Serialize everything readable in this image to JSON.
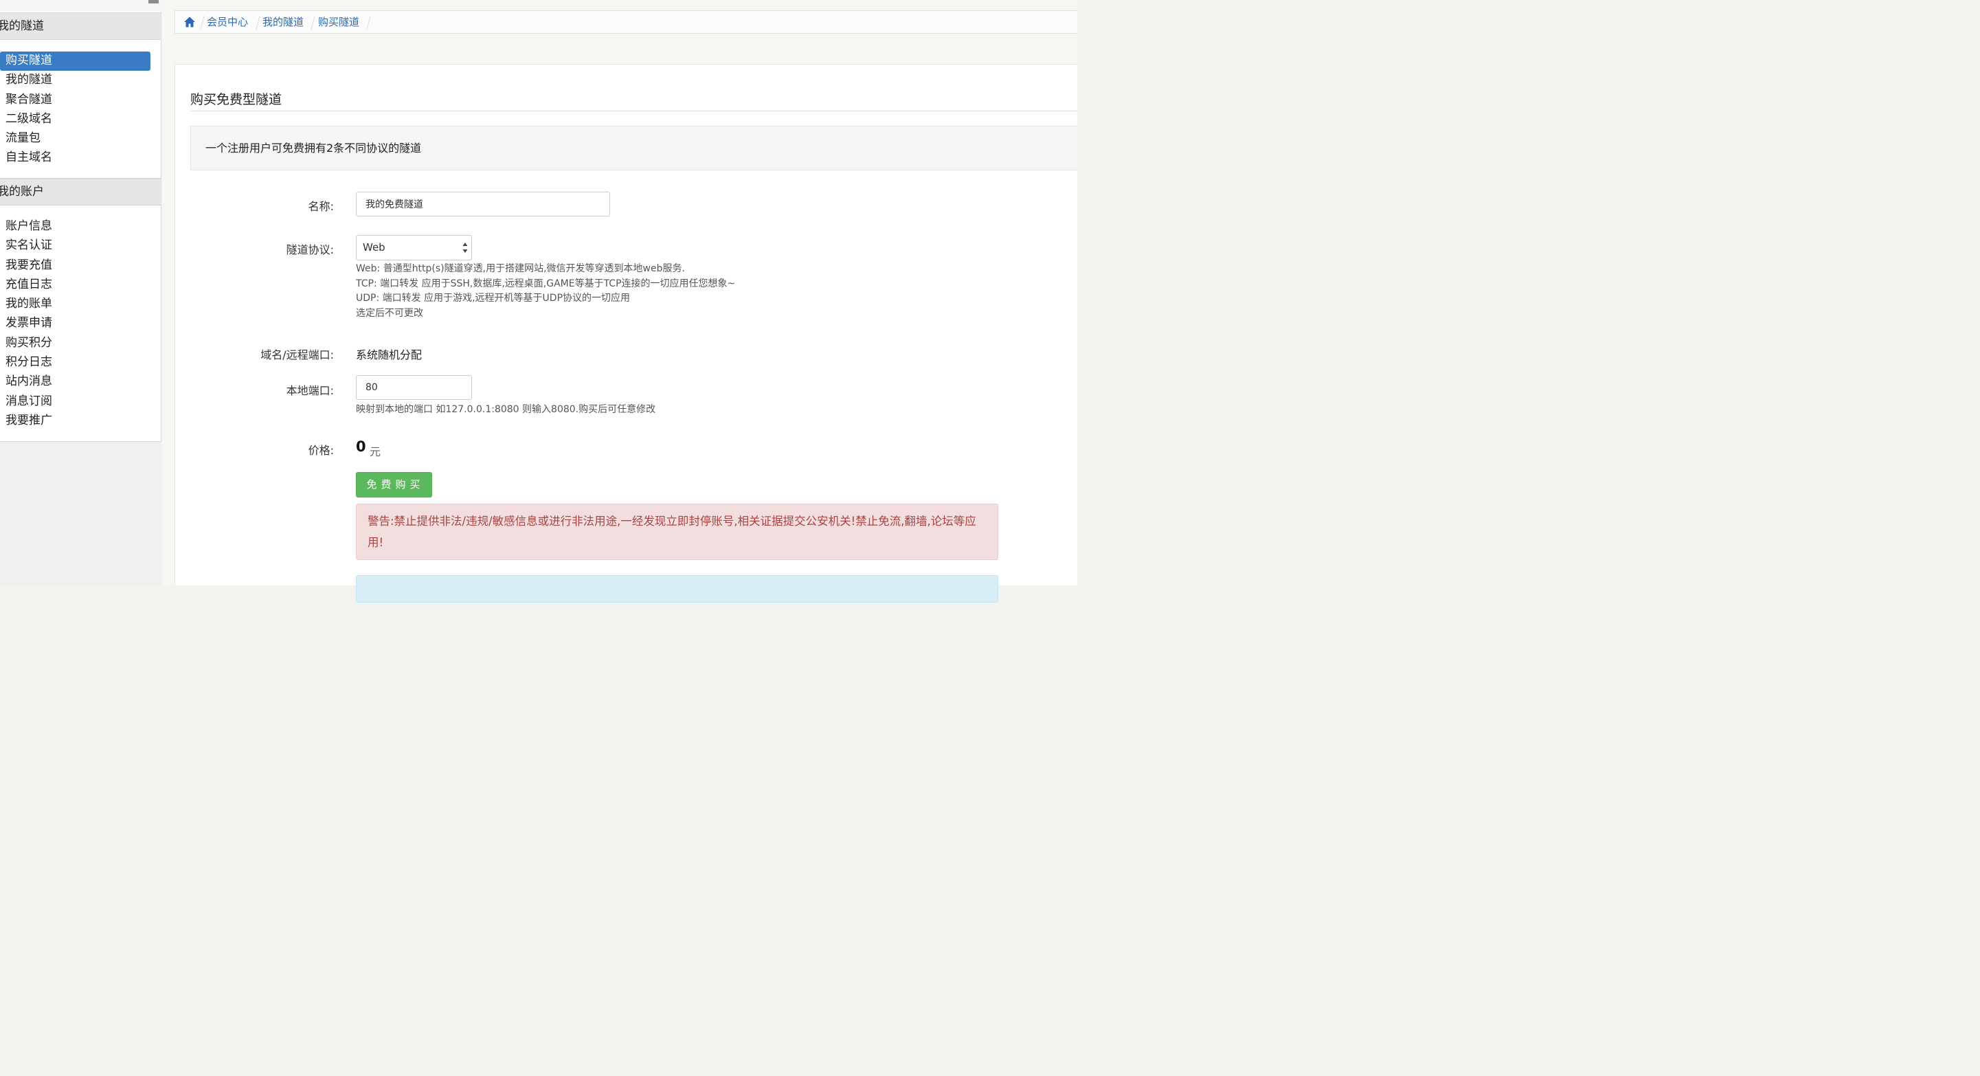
{
  "sidebar": {
    "section1_title": "我的隧道",
    "section1_items": [
      "购买隧道",
      "我的隧道",
      "聚合隧道",
      "二级域名",
      "流量包",
      "自主域名"
    ],
    "section2_title": "我的账户",
    "section2_items": [
      "账户信息",
      "实名认证",
      "我要充值",
      "充值日志",
      "我的账单",
      "发票申请",
      "购买积分",
      "积分日志",
      "站内消息",
      "消息订阅",
      "我要推广"
    ]
  },
  "breadcrumb": {
    "items": [
      "会员中心",
      "我的隧道",
      "购买隧道"
    ]
  },
  "form": {
    "title": "购买免费型隧道",
    "notice": "一个注册用户可免费拥有2条不同协议的隧道",
    "name_label": "名称:",
    "name_value": "我的免费隧道",
    "protocol_label": "隧道协议:",
    "protocol_value": "Web",
    "protocol_help": [
      "Web: 普通型http(s)隧道穿透,用于搭建网站,微信开发等穿透到本地web服务.",
      "TCP: 端口转发 应用于SSH,数据库,远程桌面,GAME等基于TCP连接的一切应用任您想象~",
      "UDP: 端口转发 应用于游戏,远程开机等基于UDP协议的一切应用",
      "选定后不可更改"
    ],
    "domain_label": "域名/远程端口:",
    "domain_value": "系统随机分配",
    "local_port_label": "本地端口:",
    "local_port_value": "80",
    "local_port_help": "映射到本地的端口 如127.0.0.1:8080 则输入8080.购买后可任意修改",
    "price_label": "价格:",
    "price_value": "0",
    "price_unit": "元",
    "buy_button": "免费购买",
    "warning": "警告:禁止提供非法/违规/敏感信息或进行非法用途,一经发现立即封停账号,相关证据提交公安机关!禁止免流,翻墙,论坛等应用!"
  },
  "colors": {
    "active_item": "#3a7cc3",
    "link": "#2a6ab3",
    "button": "#5cb85c",
    "alert_bg": "#f2dede",
    "alert_text": "#a94442",
    "info_bg": "#d9edf7"
  }
}
